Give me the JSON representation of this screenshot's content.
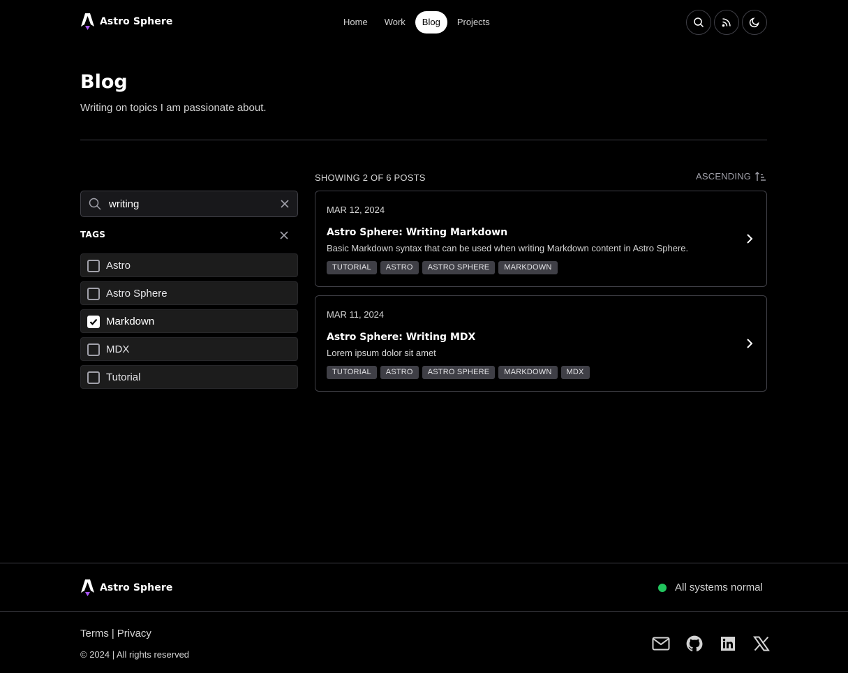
{
  "header": {
    "brand": "Astro Sphere",
    "nav": [
      {
        "label": "Home",
        "active": false
      },
      {
        "label": "Work",
        "active": false
      },
      {
        "label": "Blog",
        "active": true
      },
      {
        "label": "Projects",
        "active": false
      }
    ],
    "actions": [
      "search-icon",
      "rss-icon",
      "moon-icon"
    ]
  },
  "page": {
    "title": "Blog",
    "subtitle": "Writing on topics I am passionate about."
  },
  "filters": {
    "search_value": "writing",
    "tags_label": "TAGS",
    "tags": [
      {
        "label": "Astro",
        "checked": false
      },
      {
        "label": "Astro Sphere",
        "checked": false
      },
      {
        "label": "Markdown",
        "checked": true
      },
      {
        "label": "MDX",
        "checked": false
      },
      {
        "label": "Tutorial",
        "checked": false
      }
    ]
  },
  "results": {
    "showing": "SHOWING 2 OF 6 POSTS",
    "sort_label": "ASCENDING"
  },
  "posts": [
    {
      "date": "MAR 12, 2024",
      "title": "Astro Sphere: Writing Markdown",
      "summary": "Basic Markdown syntax that can be used when writing Markdown content in Astro Sphere.",
      "tags": [
        "TUTORIAL",
        "ASTRO",
        "ASTRO SPHERE",
        "MARKDOWN"
      ]
    },
    {
      "date": "MAR 11, 2024",
      "title": "Astro Sphere: Writing MDX",
      "summary": "Lorem ipsum dolor sit amet",
      "tags": [
        "TUTORIAL",
        "ASTRO",
        "ASTRO SPHERE",
        "MARKDOWN",
        "MDX"
      ]
    }
  ],
  "footer": {
    "brand": "Astro Sphere",
    "status": "All systems normal",
    "status_color": "#22c55e",
    "links": {
      "terms": "Terms",
      "separator": "|",
      "privacy": "Privacy"
    },
    "copyright": "© 2024 | All rights reserved",
    "socials": [
      "mail-icon",
      "github-icon",
      "linkedin-icon",
      "x-icon"
    ]
  }
}
